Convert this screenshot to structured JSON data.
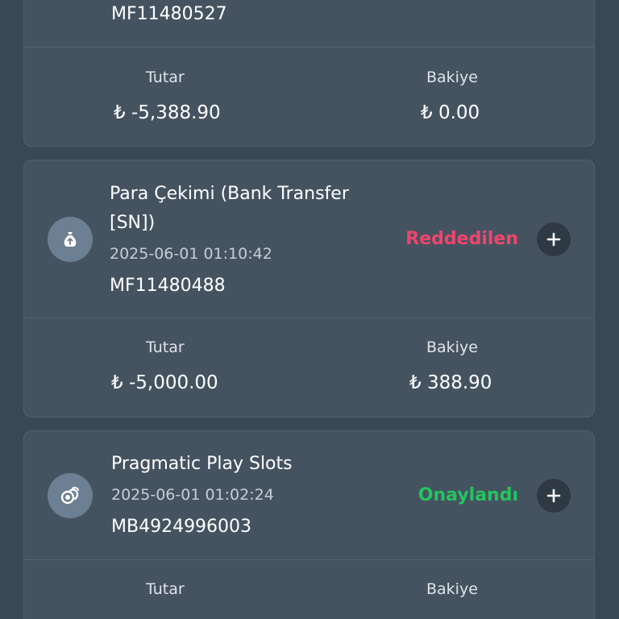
{
  "transactions": [
    {
      "title": "",
      "date": "",
      "id": "MF11480527",
      "status": "",
      "amount_label": "Tutar",
      "amount": "₺ -5,388.90",
      "balance_label": "Bakiye",
      "balance": "₺ 0.00",
      "icon": "money-bag-icon"
    },
    {
      "title": "Para Çekimi (Bank Transfer [SN])",
      "date": "2025-06-01 01:10:42",
      "id": "MF11480488",
      "status": "Reddedilen",
      "status_color": "#f0456c",
      "amount_label": "Tutar",
      "amount": "₺ -5,000.00",
      "balance_label": "Bakiye",
      "balance": "₺ 388.90",
      "icon": "money-bag-icon"
    },
    {
      "title": "Pragmatic Play Slots",
      "date": "2025-06-01 01:02:24",
      "id": "MB4924996003",
      "status": "Onaylandı",
      "status_color": "#22c55e",
      "amount_label": "Tutar",
      "amount": "",
      "balance_label": "Bakiye",
      "balance": "",
      "icon": "coins-icon"
    }
  ],
  "colors": {
    "background": "#3a4754",
    "card": "#455361",
    "icon_circle": "#6d7f92",
    "expand_button": "#2f3944"
  }
}
